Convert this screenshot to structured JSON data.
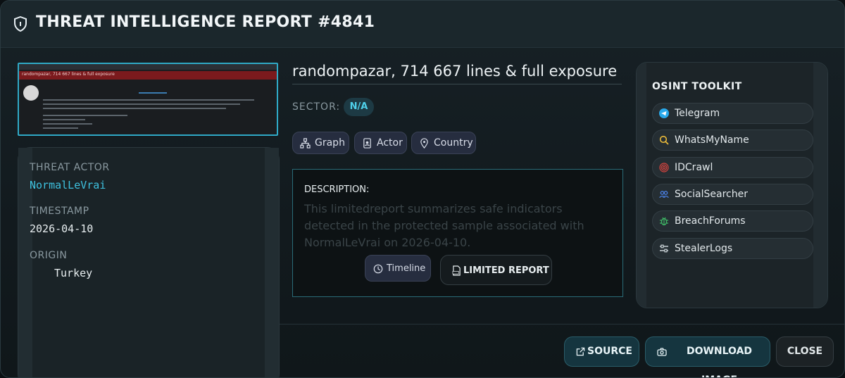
{
  "header": {
    "title": "THREAT INTELLIGENCE REPORT #4841",
    "icon": "shield-icon"
  },
  "thumbnail": {
    "title_text": "randompazar, 714 667 lines & full exposure"
  },
  "details": {
    "threat_actor_label": "THREAT ACTOR",
    "threat_actor_value": "NormalLeVrai",
    "timestamp_label": "TIMESTAMP",
    "timestamp_value": "2026-04-10",
    "origin_label": "ORIGIN",
    "origin_value": "Turkey"
  },
  "report": {
    "title": "randompazar, 714 667 lines & full exposure",
    "sector_label": "SECTOR:",
    "sector_value": "N/A",
    "pills": [
      "Graph",
      "Actor",
      "Country"
    ],
    "description_label": "DESCRIPTION:",
    "description_text": "This limitedreport summarizes safe indicators detected in the protected sample associated with NormalLeVrai on 2026-04-10.",
    "timeline_button": "Timeline",
    "limited_report_button": "LIMITED REPORT"
  },
  "osint": {
    "title": "OSINT TOOLKIT",
    "tools": [
      {
        "label": "Telegram",
        "icon": "telegram-icon",
        "color": "#29a9eb"
      },
      {
        "label": "WhatsMyName",
        "icon": "search-icon",
        "color": "#e8b93a"
      },
      {
        "label": "IDCrawl",
        "icon": "fingerprint-icon",
        "color": "#d9443f"
      },
      {
        "label": "SocialSearcher",
        "icon": "users-icon",
        "color": "#4a7fe0"
      },
      {
        "label": "BreachForums",
        "icon": "bug-icon",
        "color": "#3fb866"
      },
      {
        "label": "StealerLogs",
        "icon": "sliders-icon",
        "color": "#c9d1d6"
      }
    ]
  },
  "footer": {
    "source_button": "SOURCE",
    "download_button": "DOWNLOAD IMAGE",
    "close_button": "CLOSE"
  },
  "colors": {
    "accent": "#2fa9c6",
    "actor_name": "#3ec2e0",
    "sector_badge_text": "#4fd0ea"
  }
}
